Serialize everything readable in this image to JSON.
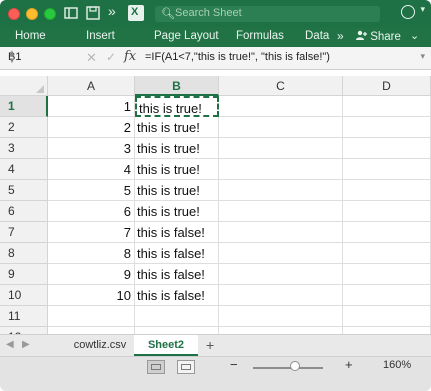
{
  "titlebar": {
    "search_placeholder": "Search Sheet"
  },
  "ribbon": {
    "tabs": [
      "Home",
      "Insert",
      "Page Layout",
      "Formulas",
      "Data"
    ],
    "more": "»",
    "share": "Share"
  },
  "formula_bar": {
    "name_box": "B1",
    "formula": "=IF(A1<7,\"this is true!\", \"this is false!\")"
  },
  "grid": {
    "columns": [
      "A",
      "B",
      "C",
      "D"
    ],
    "selected_column": "B",
    "selected_row": "1",
    "rows": [
      {
        "num": "1",
        "a": "1",
        "b": "this is true!"
      },
      {
        "num": "2",
        "a": "2",
        "b": "this is true!"
      },
      {
        "num": "3",
        "a": "3",
        "b": "this is true!"
      },
      {
        "num": "4",
        "a": "4",
        "b": "this is true!"
      },
      {
        "num": "5",
        "a": "5",
        "b": "this is true!"
      },
      {
        "num": "6",
        "a": "6",
        "b": "this is true!"
      },
      {
        "num": "7",
        "a": "7",
        "b": "this is false!"
      },
      {
        "num": "8",
        "a": "8",
        "b": "this is false!"
      },
      {
        "num": "9",
        "a": "9",
        "b": "this is false!"
      },
      {
        "num": "10",
        "a": "10",
        "b": "this is false!"
      },
      {
        "num": "11",
        "a": "",
        "b": ""
      },
      {
        "num": "12",
        "a": "",
        "b": ""
      }
    ]
  },
  "sheets": {
    "tabs": [
      "cowtliz.csv",
      "Sheet2"
    ],
    "active": "Sheet2",
    "add": "+"
  },
  "status": {
    "zoom_minus": "−",
    "zoom_plus": "+",
    "zoom": "160%",
    "zoom_level": 0.6
  },
  "colors": {
    "brand": "#217346",
    "title_bar": "#1e7145"
  }
}
